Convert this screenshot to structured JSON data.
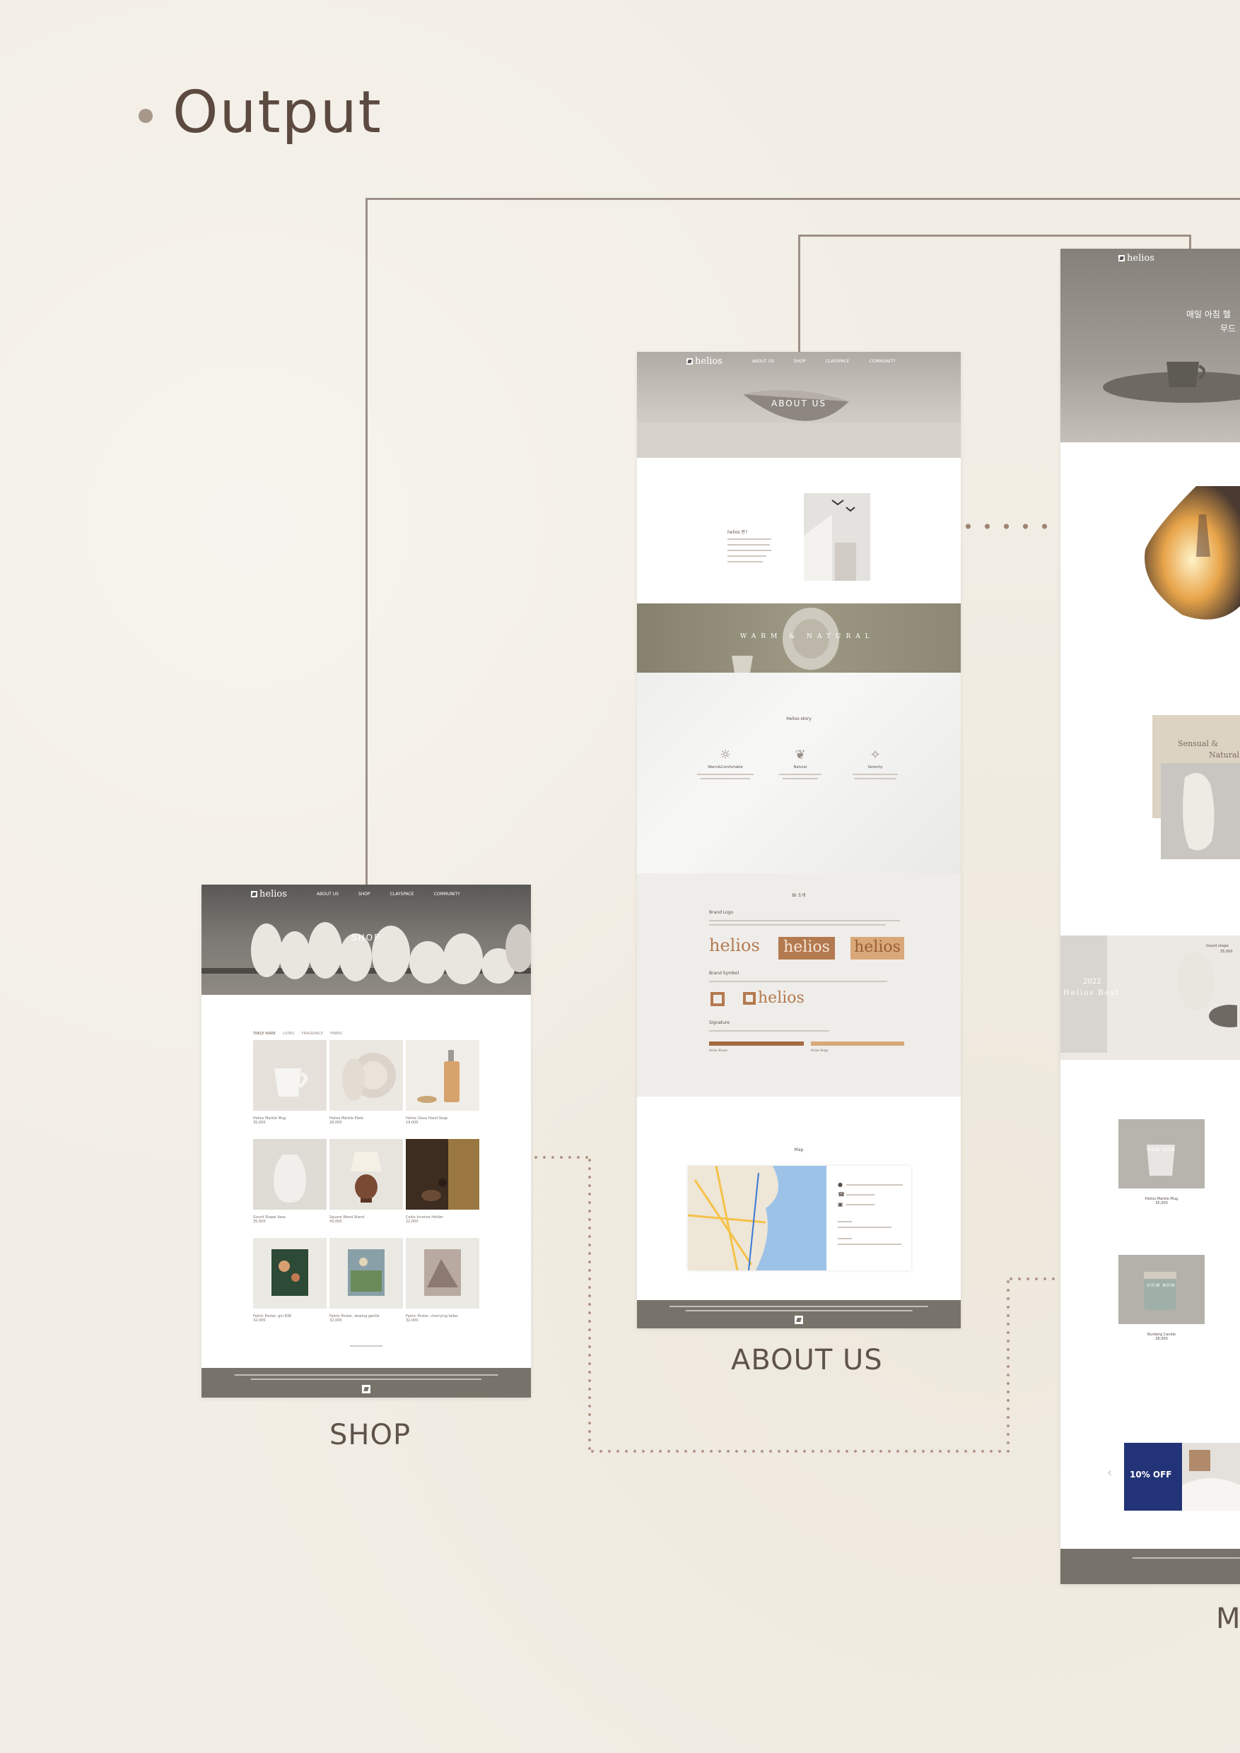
{
  "heading": {
    "title": "Output"
  },
  "captions": {
    "shop": "SHOP",
    "about": "ABOUT US",
    "main": "M"
  },
  "shop_page": {
    "logo": "helios",
    "nav": [
      "ABOUT US",
      "SHOP",
      "CLAYSPACE",
      "COMMUNITY"
    ],
    "hero": "SHOP",
    "filters": [
      "TABLE WARE",
      "LIVING",
      "FRAGRANCE",
      "FABRIC"
    ],
    "products": [
      {
        "name": "Helios Marble Mug",
        "price": "35,000"
      },
      {
        "name": "Helios Marble Plate",
        "price": "28,000"
      },
      {
        "name": "Helios Glass Hand Soap",
        "price": "19,000"
      },
      {
        "name": "Gourd Shape Vase",
        "price": "35,000"
      },
      {
        "name": "Square Wood Stand",
        "price": "43,000"
      },
      {
        "name": "Ceiko Incense Holder",
        "price": "22,000"
      },
      {
        "name": "Fabric Poster, gin 838",
        "price": "32,000"
      },
      {
        "name": "Fabric Poster, dewing gentle",
        "price": "32,000"
      },
      {
        "name": "Fabric Poster, cherrying fallen",
        "price": "32,000"
      }
    ]
  },
  "about_page": {
    "logo": "helios",
    "nav": [
      "ABOUT US",
      "SHOP",
      "CLAYSPACE",
      "COMMUNITY"
    ],
    "hero": "ABOUT US",
    "intro_title": "helios 란?",
    "banner": "WARM & NATURAL",
    "story_title": "Helios story",
    "story_items": [
      "Warm&Comfortable",
      "Natural",
      "Serenity"
    ],
    "bi_title": "BI 소개",
    "brand_logo": "Brand Logo",
    "logo_word": "helios",
    "brand_symbol": "Brand Symbol",
    "signature": "Signature",
    "signature_colors": [
      "Helios Brown",
      "Helios Beige"
    ],
    "map_title": "Map"
  },
  "main_page": {
    "logo": "helios",
    "hero_text": "매일 아침 헬",
    "hero_text2": "무드",
    "sensual": "Sensual &",
    "natural": "Natural",
    "best_year": "2022",
    "best_label": "Helios Best",
    "best_item": "Gourd shape",
    "best_price": "35,000",
    "view_now": "VIEW NOW",
    "new_items": [
      {
        "name": "Helios Marble Mug",
        "price": "35,000"
      },
      {
        "name": "Bunberg Candle",
        "price": "28,000"
      }
    ],
    "promo": "10% OFF"
  },
  "colors": {
    "brand_brown": "#b47a4f",
    "brand_beige": "#d8a878",
    "footer": "#77736a",
    "accent_dots": "#b09585"
  }
}
